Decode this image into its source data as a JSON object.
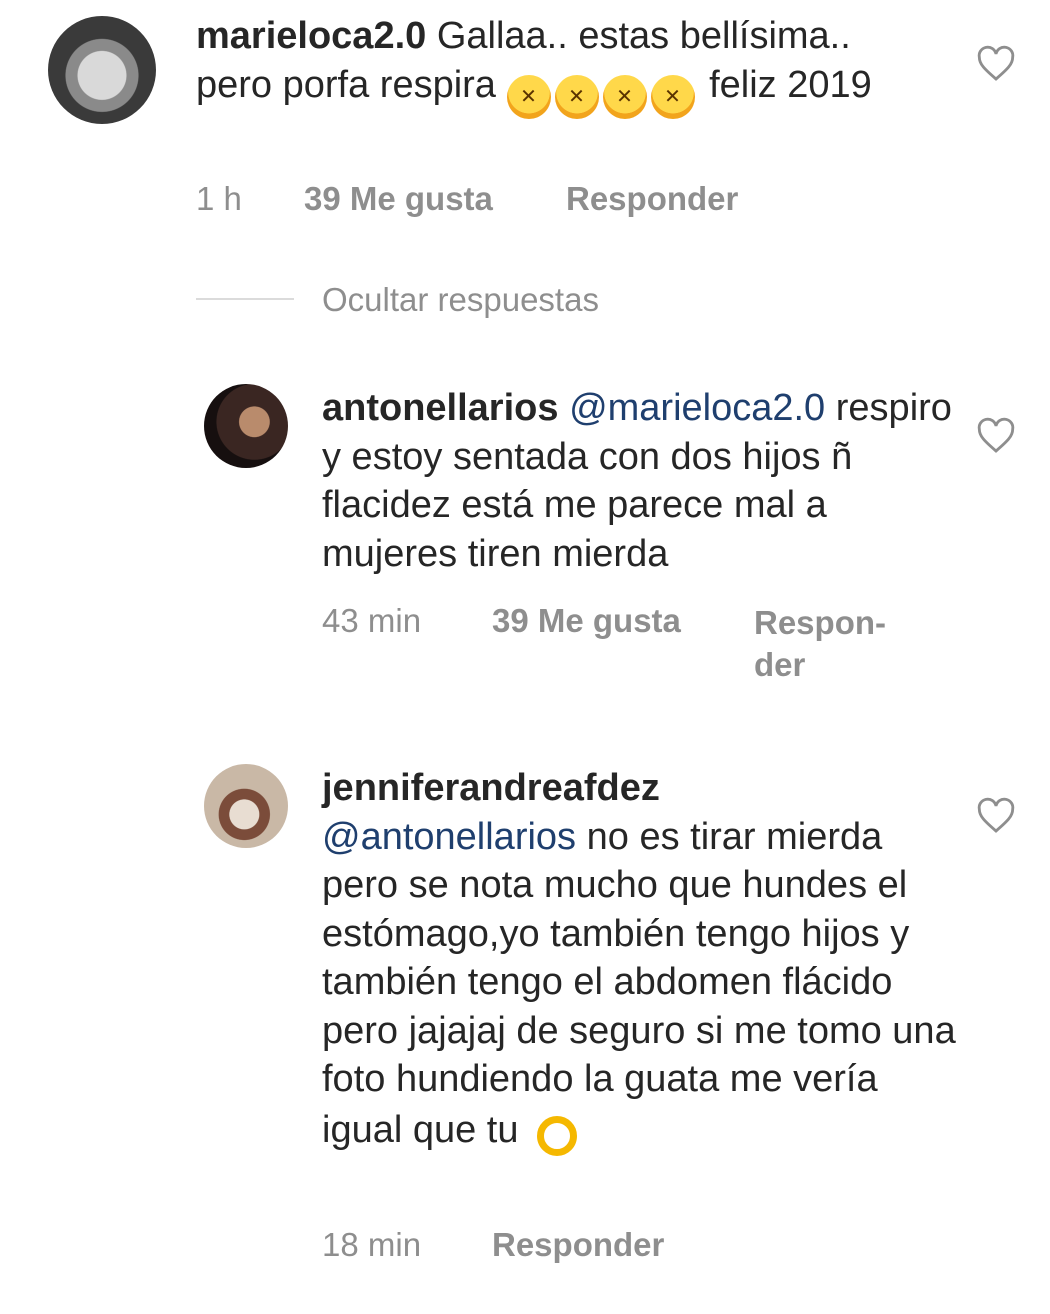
{
  "comments": [
    {
      "username": "marieloca2.0",
      "text_before": "Gallaa.. estas bellísima.. pero porfa respira",
      "emojis": [
        "rolling-on-floor-laughing",
        "rolling-on-floor-laughing",
        "rolling-on-floor-laughing",
        "rolling-on-floor-laughing"
      ],
      "text_after": "feliz 2019",
      "time": "1 h",
      "likes": "39 Me gusta",
      "reply": "Responder"
    },
    {
      "username": "antonellarios",
      "mention": "@marieloca2.0",
      "text": "respiro y estoy sentada con dos hijos ñ flacidez  está me parece mal a mujeres tiren mierda",
      "time": "43 min",
      "likes": "39 Me gusta",
      "reply": "Respon-",
      "reply_cont": "der"
    },
    {
      "username": "jenniferandreafdez",
      "mention": "@antonellarios",
      "text": "no es tirar mierda pero se nota mucho que hundes el estómago,yo también tengo hijos y también tengo el abdomen flácido pero jajajaj de seguro si me tomo una foto hundiendo la guata me vería igual que tu",
      "emoji": "ok-hand",
      "time": "18 min",
      "reply": "Responder"
    }
  ],
  "replies_toggle": "Ocultar respuestas",
  "icons": {
    "like": "heart-outline-icon"
  },
  "colors": {
    "text": "#262626",
    "meta": "#8e8e8e",
    "mention": "#1f3f6e"
  }
}
